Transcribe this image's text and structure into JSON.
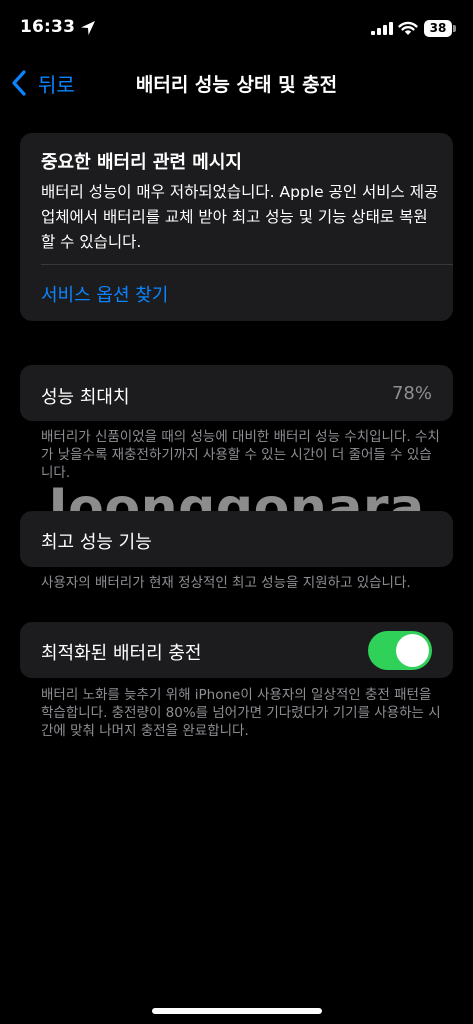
{
  "status_bar": {
    "time": "16:33",
    "battery_level": "38"
  },
  "nav": {
    "back_label": "뒤로",
    "title": "배터리 성능 상태 및 충전"
  },
  "alert_card": {
    "title": "중요한 배터리 관련 메시지",
    "body": "배터리 성능이 매우 저하되었습니다. Apple 공인 서비스 제공업체에서 배터리를 교체 받아 최고 성능 및 기능 상태로 복원할 수 있습니다.",
    "link": "서비스 옵션 찾기"
  },
  "max_capacity": {
    "label": "성능 최대치",
    "value": "78%",
    "note": "배터리가 신품이었을 때의 성능에 대비한 배터리 성능 수치입니다. 수치가 낮을수록 재충전하기까지 사용할 수 있는 시간이 더 줄어들 수 있습니다."
  },
  "peak_performance": {
    "label": "최고 성능 기능",
    "note": "사용자의 배터리가 현재 정상적인 최고 성능을 지원하고 있습니다."
  },
  "optimized_charging": {
    "label": "최적화된 배터리 충전",
    "toggle_on": true,
    "note": "배터리 노화를 늦추기 위해 iPhone이 사용자의 일상적인 충전 패턴을 학습합니다. 충전량이 80%를 넘어가면 기다렸다가 기기를 사용하는 시간에 맞춰 나머지 충전을 완료합니다."
  },
  "watermark": "Joonggonara",
  "colors": {
    "accent": "#0a84ff",
    "toggle_on": "#30d158",
    "card_bg": "#1c1c1e",
    "secondary_text": "#8e8e93"
  }
}
